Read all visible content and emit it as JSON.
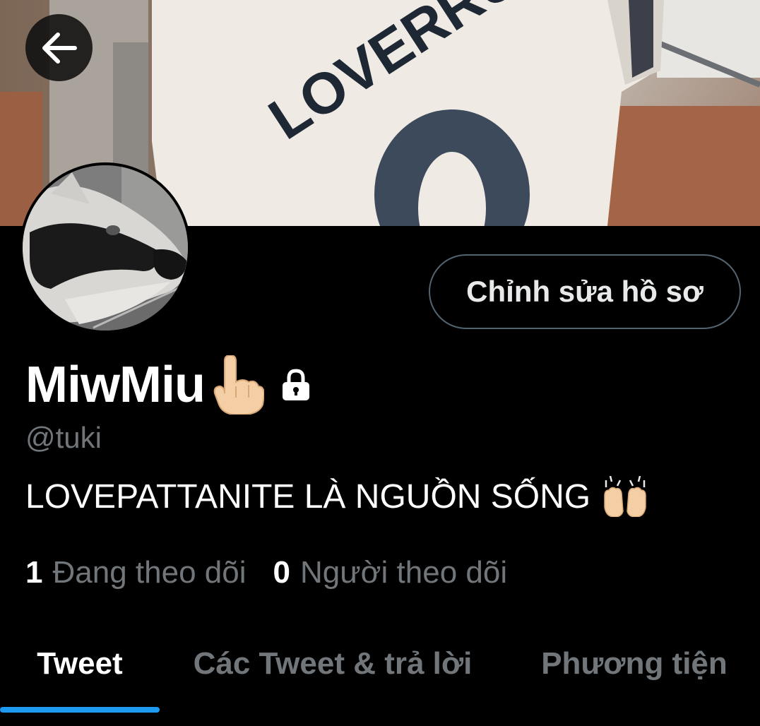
{
  "header": {
    "back_icon": "arrow-left-icon"
  },
  "banner": {
    "jersey_text": "LOVERRUKK"
  },
  "profile": {
    "edit_button_label": "Chỉnh sửa hồ sơ",
    "display_name": "MiwMiu",
    "name_emoji_icon": "pointing-up-hand-icon",
    "locked_icon": "lock-icon",
    "handle": "@tuki",
    "bio": "LOVEPATTANITE LÀ NGUỒN SỐNG",
    "bio_emoji_icon": "raising-hands-icon"
  },
  "stats": {
    "following_count": "1",
    "following_label": "Đang theo dõi",
    "followers_count": "0",
    "followers_label": "Người theo dõi"
  },
  "tabs": [
    {
      "label": "Tweet",
      "active": true
    },
    {
      "label": "Các Tweet & trả lời",
      "active": false
    },
    {
      "label": "Phương tiện",
      "active": false
    }
  ],
  "colors": {
    "background": "#000000",
    "primary_text": "#ffffff",
    "secondary_text": "#71767b",
    "accent": "#1d9bf0",
    "button_border": "#536471"
  }
}
